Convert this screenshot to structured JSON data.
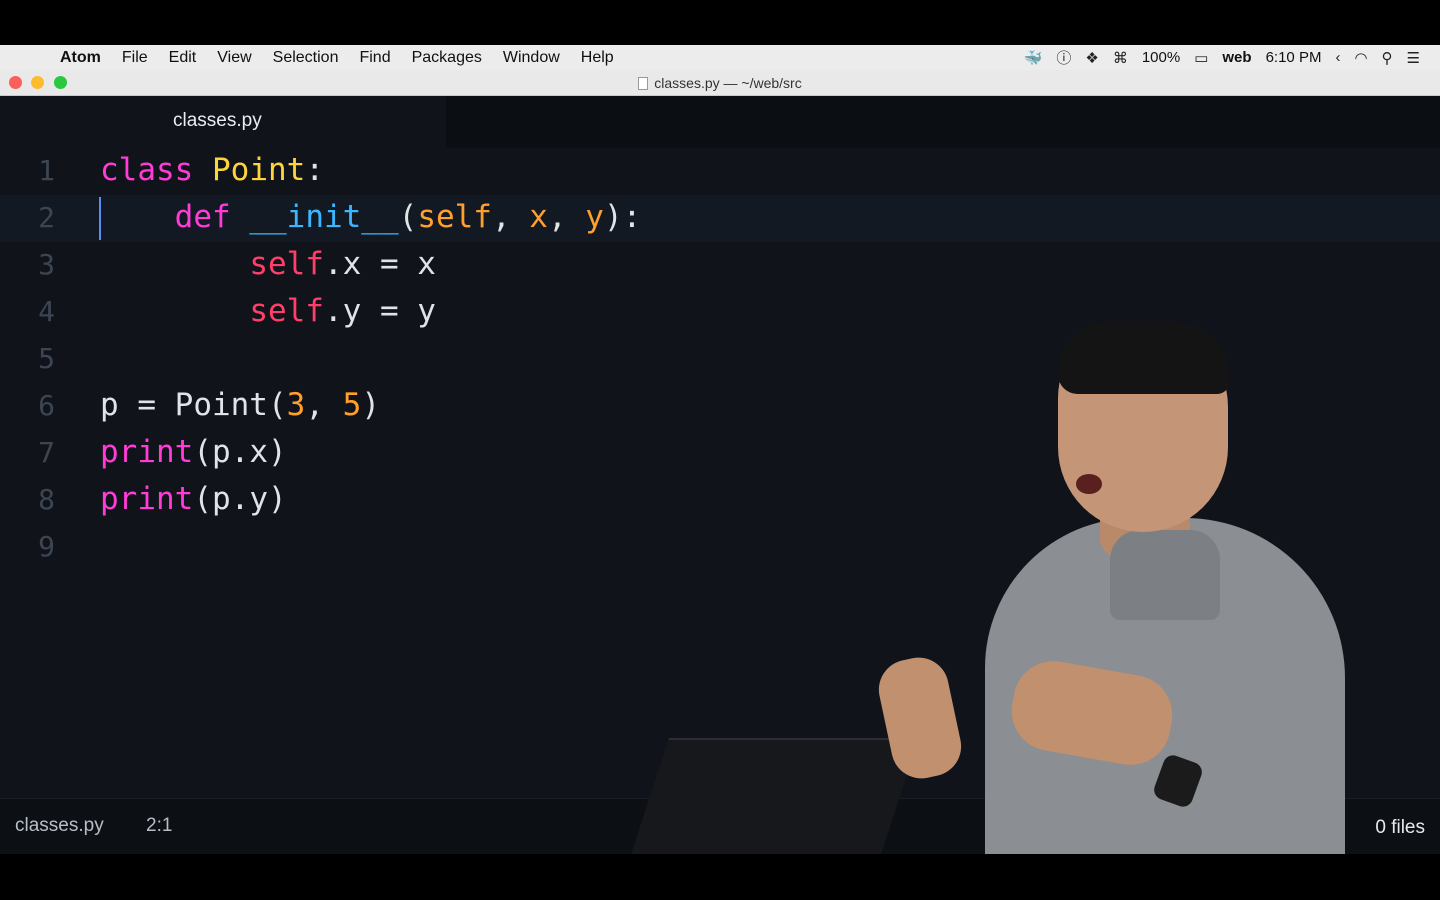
{
  "menubar": {
    "app": "Atom",
    "items": [
      "File",
      "Edit",
      "View",
      "Selection",
      "Find",
      "Packages",
      "Window",
      "Help"
    ],
    "battery": "100%",
    "user": "web",
    "clock": "6:10 PM"
  },
  "window": {
    "title": "classes.py — ~/web/src"
  },
  "tab": {
    "label": "classes.py"
  },
  "editor": {
    "line_numbers": [
      "1",
      "2",
      "3",
      "4",
      "5",
      "6",
      "7",
      "8",
      "9"
    ],
    "current_line": 2
  },
  "statusbar": {
    "file": "classes.py",
    "cursor": "2:1",
    "files": "0 files"
  },
  "colors": {
    "keyword": "#ff3bd8",
    "class_name": "#ffd43a",
    "function": "#3cb7ff",
    "parameter": "#ff9f2d",
    "self": "#ff3f6a",
    "background": "#10141a"
  }
}
